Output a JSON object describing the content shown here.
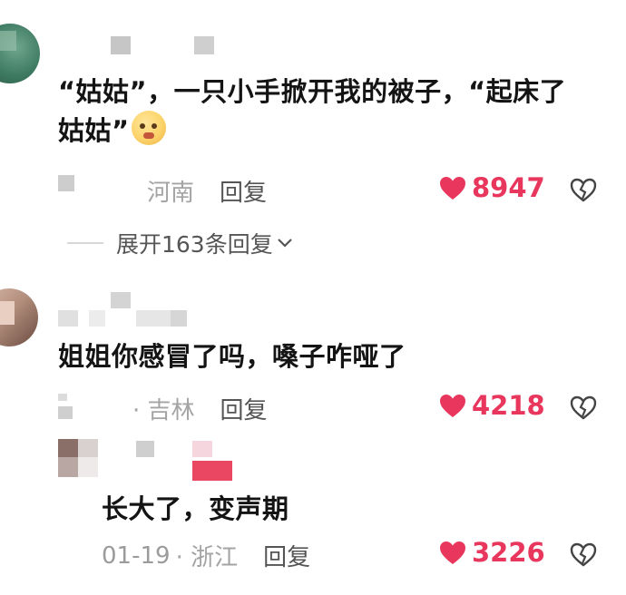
{
  "comments": [
    {
      "text_line1": "“姑姑”，一只小手掀开我的被子，“起床了",
      "text_line2": "姑姑”",
      "emoji": "pleading-face-emoji",
      "location": "河南",
      "reply_label": "回复",
      "likes": "8947",
      "expand_label": "展开163条回复"
    },
    {
      "text": "姐姐你感冒了吗，嗓子咋哑了",
      "location": "· 吉林",
      "reply_label": "回复",
      "likes": "4218"
    },
    {
      "text": "长大了，变声期",
      "date": "01-19",
      "location": "· 浙江",
      "reply_label": "回复",
      "likes": "3226"
    }
  ],
  "colors": {
    "like_red": "#e8365d",
    "meta_gray": "#9b9b9b",
    "reply_gray": "#555555"
  }
}
